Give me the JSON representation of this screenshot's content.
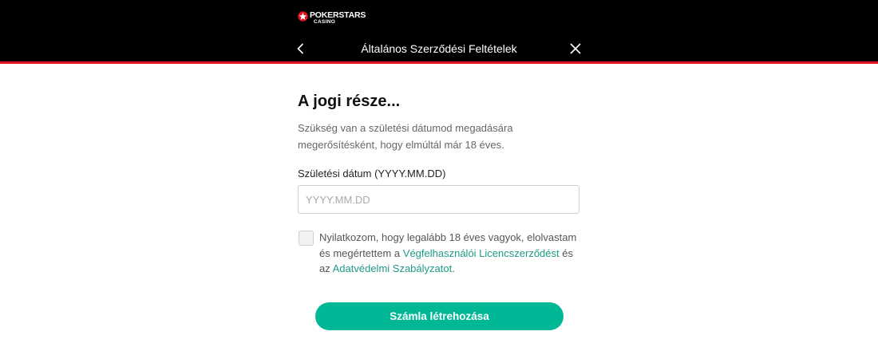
{
  "header": {
    "brand_name": "POKERSTARS",
    "brand_sub": "CASINO",
    "title": "Általános Szerződési Feltételek",
    "colors": {
      "background": "#000000",
      "accent_bar": "#e0141e"
    }
  },
  "main": {
    "heading": "A jogi része...",
    "description": "Szükség van a születési dátumod megadására megerősítésként, hogy elmúltál már 18 éves.",
    "dob_label": "Születési dátum (YYYY.MM.DD)",
    "dob_placeholder": "YYYY.MM.DD",
    "dob_value": "",
    "consent": {
      "checked": false,
      "text_before": "Nyilatkozom, hogy legalább 18 éves vagyok, elolvastam és megértettem a ",
      "link1": "Végfelhasználói Licencszerződést",
      "text_middle": " és az ",
      "link2": "Adatvédelmi Szabályzatot",
      "text_after": "."
    },
    "submit_label": "Számla létrehozása",
    "colors": {
      "primary_button": "#00b896",
      "link": "#1d9a84"
    }
  },
  "icons": {
    "logo": "star-logo-icon",
    "back": "chevron-left-icon",
    "close": "close-icon"
  }
}
